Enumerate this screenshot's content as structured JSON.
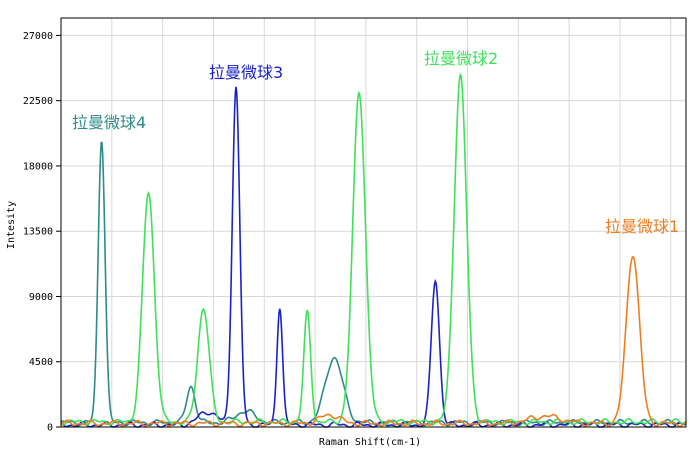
{
  "chart_data": {
    "type": "line",
    "xlabel": "Raman Shift(cm-1)",
    "ylabel": "Intesity",
    "ylim": [
      0,
      28200
    ],
    "xlim": [
      0,
      100
    ],
    "y_ticks": [
      0,
      4500,
      9000,
      13500,
      18000,
      22500,
      27000
    ],
    "y_tick_labels": [
      "0",
      "4500",
      "9000",
      "13500",
      "18000",
      "22500",
      "27000"
    ],
    "grid": true,
    "series": [
      {
        "name": "拉曼微球4",
        "color": "#2e8b8b",
        "baseline": 300,
        "peaks": [
          [
            6.5,
            19600,
            0.55
          ],
          [
            20.8,
            2500,
            0.7
          ],
          [
            43.7,
            4500,
            1.4
          ],
          [
            29.5,
            800,
            1.5
          ]
        ]
      },
      {
        "name": "拉曼微球3",
        "color": "#1a23c8",
        "baseline": 150,
        "peaks": [
          [
            28.0,
            23300,
            0.6
          ],
          [
            35.0,
            8200,
            0.45
          ],
          [
            59.9,
            10000,
            0.65
          ],
          [
            23.5,
            900,
            1.5
          ]
        ]
      },
      {
        "name": "拉曼微球2",
        "color": "#3fe05a",
        "baseline": 350,
        "peaks": [
          [
            14.0,
            15800,
            0.95
          ],
          [
            22.8,
            7900,
            0.9
          ],
          [
            39.4,
            7500,
            0.55
          ],
          [
            47.7,
            22800,
            1.0
          ],
          [
            63.9,
            23900,
            1.0
          ]
        ]
      },
      {
        "name": "拉曼微球1",
        "color": "#f07d1f",
        "baseline": 250,
        "peaks": [
          [
            91.5,
            11700,
            1.05
          ],
          [
            77.5,
            500,
            2.5
          ],
          [
            43.0,
            600,
            1.5
          ]
        ]
      }
    ]
  }
}
